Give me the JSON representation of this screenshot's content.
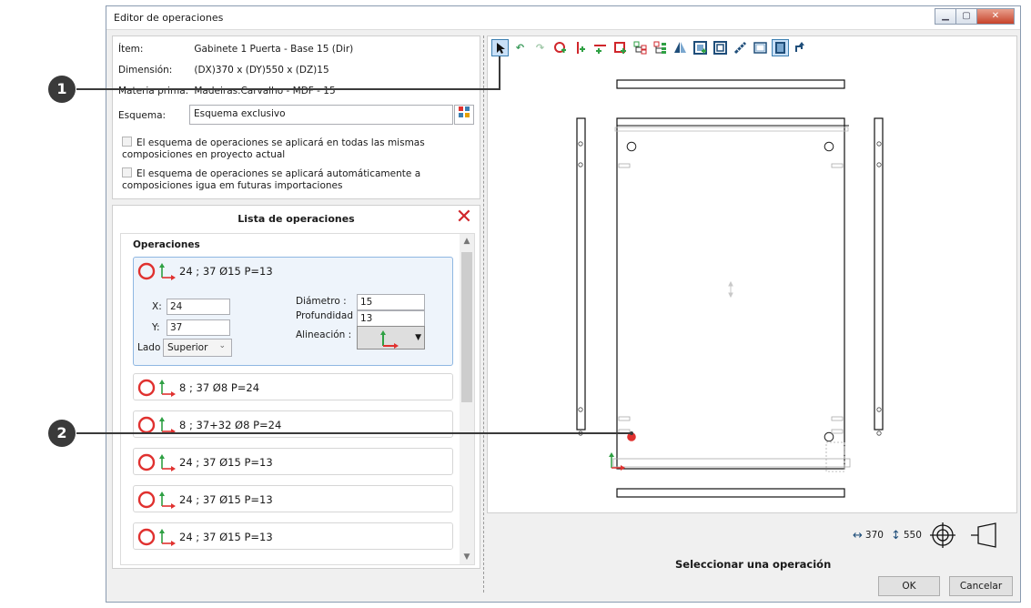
{
  "window": {
    "title": "Editor de operaciones",
    "controls": [
      "minimize",
      "maximize",
      "close"
    ]
  },
  "info": {
    "item_label": "Ítem:",
    "item_value": "Gabinete 1 Puerta - Base 15  (Dir)",
    "dimension_label": "Dimensión:",
    "dimension_value": "(DX)370 x (DY)550 x (DZ)15",
    "material_label": "Materia prima:",
    "material_value": "Madeiras.Carvalho - MDF - 15",
    "schema_label": "Esquema:",
    "schema_value": "Esquema exclusivo",
    "check1": "El esquema de operaciones se aplicará en todas las mismas composiciones en proyecto actual",
    "check2": "El esquema de operaciones se aplicará automáticamente a composiciones igua em futuras importaciones"
  },
  "operations": {
    "panel_title": "Lista de operaciones",
    "heading": "Operaciones",
    "items": [
      {
        "label": "24 ; 37 Ø15 P=13",
        "icon": "hole-circle-icon"
      },
      {
        "label": "8 ; 37 Ø8 P=24",
        "icon": "hole-circle-icon"
      },
      {
        "label": "8 ; 37+32 Ø8 P=24",
        "icon": "hole-circle-icon"
      },
      {
        "label": "24 ; 37 Ø15 P=13",
        "icon": "hole-circle-icon"
      },
      {
        "label": "24 ; 37 Ø15 P=13",
        "icon": "hole-circle-icon"
      },
      {
        "label": "24 ; 37 Ø15 P=13",
        "icon": "hole-circle-icon"
      }
    ],
    "detail": {
      "x_label": "X:",
      "x_value": "24",
      "y_label": "Y:",
      "y_value": "37",
      "side_label": "Lado :",
      "side_value": "Superior",
      "diameter_label": "Diámetro :",
      "diameter_value": "15",
      "depth_label": "Profundidad :",
      "depth_value": "13",
      "alignment_label": "Alineación :"
    }
  },
  "toolbar": {
    "tools": [
      "select-arrow-icon",
      "undo-icon",
      "redo-icon",
      "add-hole-icon",
      "add-groove-icon",
      "add-cut-icon",
      "add-rect-icon",
      "tree-icon",
      "tree-list-icon",
      "mirror-icon",
      "frame-add-icon",
      "frame-icon",
      "measure-icon",
      "panel-outline-icon",
      "panel-fill-icon",
      "rotate-corner-icon"
    ]
  },
  "status": {
    "dim_x": "370",
    "dim_y": "550",
    "message": "Seleccionar una operación"
  },
  "buttons": {
    "ok": "OK",
    "cancel": "Cancelar"
  },
  "callouts": {
    "one": "1",
    "two": "2"
  },
  "colors": {
    "accent": "#3c7fb1",
    "hole_red": "#e0312f",
    "close_red": "#d0262b"
  }
}
